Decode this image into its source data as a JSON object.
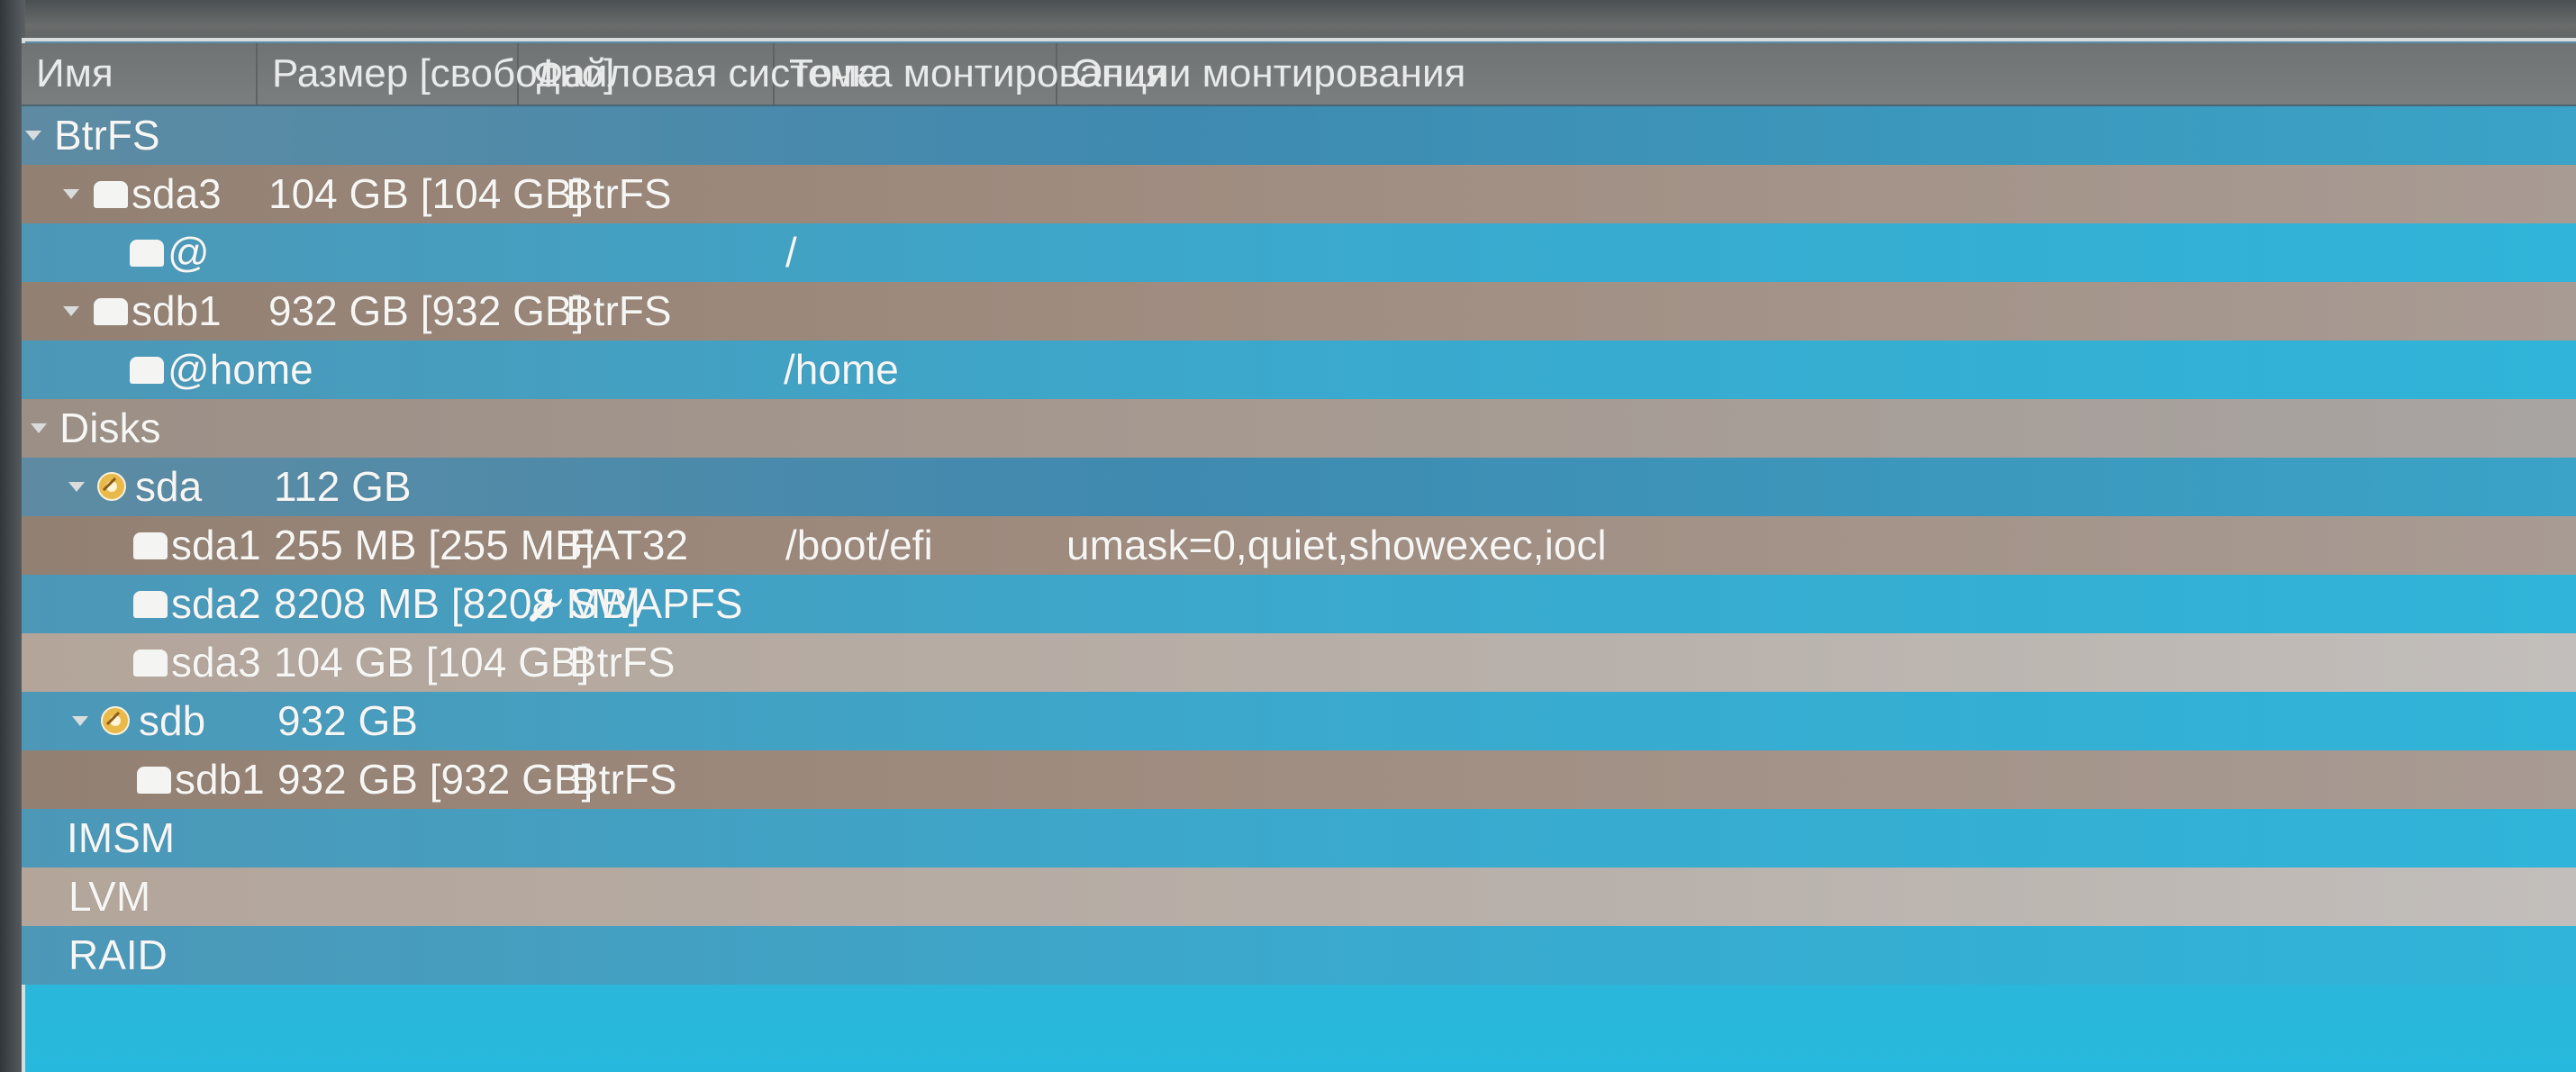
{
  "columns": {
    "name": "Имя",
    "size": "Размер [свободно]",
    "fs": "Файловая система",
    "mount": "Точка монтирования",
    "options": "Опции монтирования"
  },
  "rows": {
    "btrfs_group": {
      "name": "BtrFS"
    },
    "btrfs_sda3": {
      "name": "sda3",
      "size": "104 GB [104 GB]",
      "fs": "BtrFS"
    },
    "btrfs_sda3_root": {
      "name": "@",
      "mount": "/"
    },
    "btrfs_sdb1": {
      "name": "sdb1",
      "size": "932 GB [932 GB]",
      "fs": "BtrFS"
    },
    "btrfs_sdb1_home": {
      "name": "@home",
      "mount": "/home"
    },
    "disks_group": {
      "name": "Disks"
    },
    "disk_sda": {
      "name": "sda",
      "size": "112 GB"
    },
    "sda1": {
      "name": "sda1",
      "size": "255 MB [255 MB]",
      "fs": "FAT32",
      "mount": "/boot/efi",
      "options": "umask=0,quiet,showexec,iocl"
    },
    "sda2": {
      "name": "sda2",
      "size": "8208 MB [8208 MB]",
      "fs": "SWAPFS"
    },
    "sda3": {
      "name": "sda3",
      "size": "104 GB [104 GB]",
      "fs": "BtrFS"
    },
    "disk_sdb": {
      "name": "sdb",
      "size": "932 GB"
    },
    "sdb1": {
      "name": "sdb1",
      "size": "932 GB [932 GB]",
      "fs": "BtrFS"
    },
    "imsm_group": {
      "name": "IMSM"
    },
    "lvm_group": {
      "name": "LVM"
    },
    "raid_group": {
      "name": "RAID"
    }
  },
  "icons": {
    "expander": "expand-arrow-icon",
    "partition": "partition-icon",
    "disk": "disk-icon",
    "swap": "wrench-icon"
  }
}
